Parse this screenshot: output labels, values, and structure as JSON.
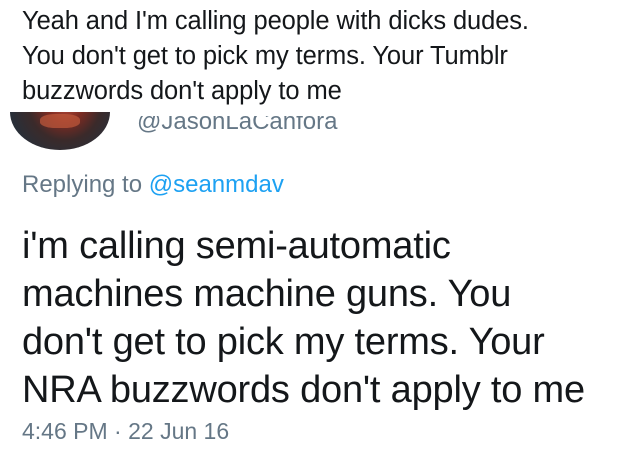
{
  "top_tweet": {
    "lines": [
      "Yeah and I'm calling people with dicks dudes.",
      "You don't get to pick my terms. Your Tumblr",
      "buzzwords don't apply to me"
    ]
  },
  "author": {
    "handle": "@JasonLaCanfora"
  },
  "reply": {
    "prefix": "Replying to ",
    "mention": "@seanmdav"
  },
  "main_tweet": {
    "lines": [
      "i'm calling semi-automatic",
      "machines machine guns. You",
      "don't get to pick my terms. Your",
      "NRA buzzwords don't apply to me"
    ]
  },
  "meta": {
    "timestamp": "4:46 PM · 22 Jun 16"
  }
}
